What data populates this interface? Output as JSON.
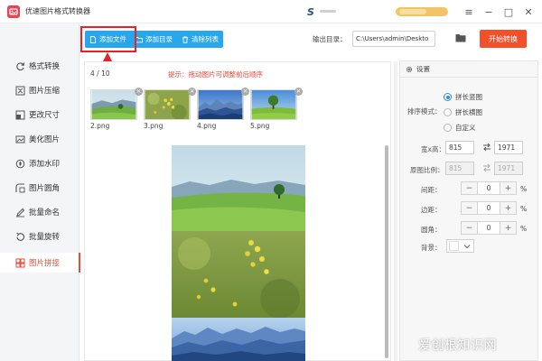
{
  "app": {
    "title": "优速图片格式转换器"
  },
  "window_controls": {
    "menu": "≡",
    "minimize": "−",
    "maximize": "□",
    "close": "✕"
  },
  "sidebar": {
    "items": [
      {
        "label": "格式转换",
        "icon": "refresh-icon"
      },
      {
        "label": "图片压缩",
        "icon": "compress-icon"
      },
      {
        "label": "更改尺寸",
        "icon": "resize-icon"
      },
      {
        "label": "美化图片",
        "icon": "beautify-icon"
      },
      {
        "label": "添加水印",
        "icon": "watermark-icon"
      },
      {
        "label": "图片圆角",
        "icon": "round-corner-icon"
      },
      {
        "label": "批量命名",
        "icon": "rename-icon"
      },
      {
        "label": "批量旋转",
        "icon": "rotate-icon"
      },
      {
        "label": "图片拼接",
        "icon": "stitch-icon",
        "active": true
      }
    ]
  },
  "toolbar": {
    "add_file": "添加文件",
    "add_folder": "添加目录",
    "clear_list": "清除列表",
    "output_label": "输出目录：",
    "output_path": "C:\\Users\\admin\\Deskto",
    "start_button": "开始转换"
  },
  "workarea": {
    "count": "4 / 10",
    "hint": "提示：拖动图片可调整前后顺序",
    "files": [
      "2.png",
      "3.png",
      "4.png",
      "5.png"
    ]
  },
  "settings": {
    "title": "设置",
    "sort_label": "排序模式：",
    "sort_options": [
      "拼长竖图",
      "拼长横图",
      "自定义"
    ],
    "size_label": "宽x高：",
    "width": "815",
    "height": "1971",
    "ratio_label": "原图比例：",
    "ratio_width": "815",
    "ratio_height": "1971",
    "spacing_label": "间距：",
    "spacing_value": "0",
    "margin_label": "边距：",
    "margin_value": "0",
    "corner_label": "圆角：",
    "corner_value": "0",
    "unit": "%",
    "background_label": "背景："
  },
  "watermark": {
    "text": "爱创根知识网"
  },
  "colors": {
    "accent_blue": "#2aa6ea",
    "start_orange": "#f2502a",
    "active_red": "#e84c3d",
    "highlight_red": "#e8202a"
  }
}
